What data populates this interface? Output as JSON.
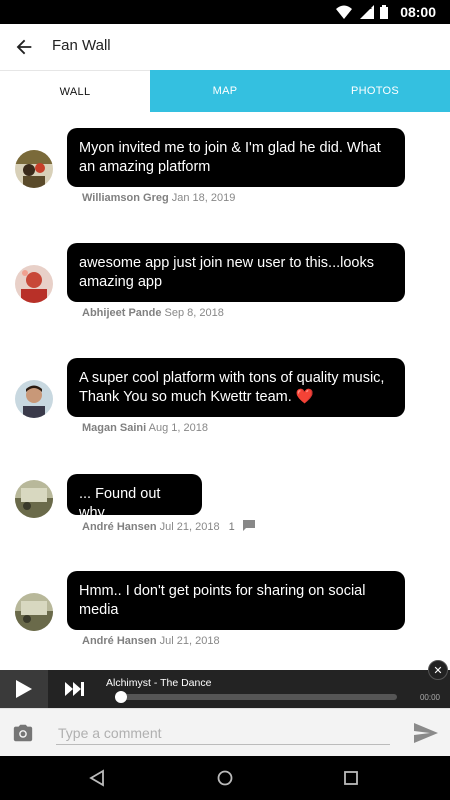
{
  "status_bar": {
    "time": "08:00",
    "network": "LTE"
  },
  "header": {
    "title": "Fan Wall"
  },
  "tabs": [
    {
      "label": "WALL",
      "active": true
    },
    {
      "label": "MAP",
      "active": false
    },
    {
      "label": "PHOTOS",
      "active": false
    }
  ],
  "posts": [
    {
      "text": "Myon invited me to join & I'm glad he did. What an amazing platform",
      "author": "Williamson Greg",
      "date": "Jan 18, 2019"
    },
    {
      "text": "awesome app just join new user to this...looks amazing app",
      "author": "Abhijeet Pande",
      "date": "Sep 8, 2018"
    },
    {
      "text": "A super cool platform with tons of quality music, Thank You so much Kwettr team. ❤️",
      "author": "Magan Saini",
      "date": "Aug 1, 2018"
    },
    {
      "text": "... Found out why",
      "author": "André Hansen",
      "date": "Jul 21, 2018",
      "comment_count": "1"
    },
    {
      "text": "Hmm.. I don't get points for sharing on social media",
      "author": "André Hansen",
      "date": "Jul 21, 2018"
    }
  ],
  "player": {
    "track": "Alchimyst - The Dance",
    "elapsed": "00:00",
    "progress": 0
  },
  "composer": {
    "placeholder": "Type a comment"
  },
  "colors": {
    "tab_accent": "#34c0e0",
    "bubble": "#000000",
    "player_bg": "#232323"
  }
}
